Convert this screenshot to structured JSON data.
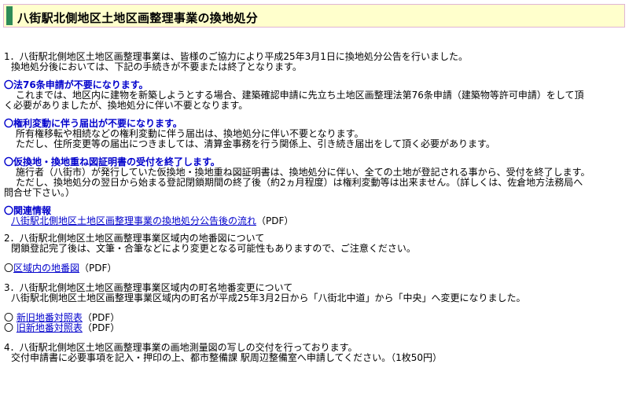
{
  "page": {
    "title": "八街駅北側地区土地区画整理事業の換地処分"
  },
  "section1": {
    "line1": "1．八街駅北側地区土地区画整理事業は、皆様のご協力により平成25年3月1日に換地処分公告を行いました。",
    "line2": "換地処分後においては、下記の手続きが不要または終了となります。"
  },
  "item76": {
    "heading": "〇法76条申請が不要になります。",
    "line1": "これまでは、地区内に建物を新築しようとする場合、建築確認申請に先立ち土地区画整理法第76条申請（建築物等許可申請）をして頂",
    "line2": "く必要がありましたが、換地処分に伴い不要となります。"
  },
  "itemRights": {
    "heading": "〇権利変動に伴う届出が不要になります。",
    "line1": "所有権移転や相続などの権利変動に伴う届出は、換地処分に伴い不要となります。",
    "line2": "ただし、住所変更等の届出につきましては、清算金事務を行う関係上、引き続き届出をして頂く必要があります。"
  },
  "itemCert": {
    "heading": "〇仮換地・換地重ね図証明書の受付を終了します。",
    "line1": "施行者（八街市）が発行していた仮換地・換地重ね図証明書は、換地処分に伴い、全ての土地が登記される事から、受付を終了します。",
    "line2": "ただし、換地処分の翌日から始まる登記閉鎖期間の終了後（約2ヵ月程度）は権利変動等は出来ません。（詳しくは、佐倉地方法務局へ",
    "line3": "問合せ下さい。）"
  },
  "related": {
    "heading": "〇関連情報",
    "link": "八街駅北側地区土地区画整理事業の換地処分公告後の流れ",
    "suffix": "（PDF）"
  },
  "section2": {
    "line1": "2．八街駅北側地区土地区画整理事業区域内の地番図について",
    "line2": "閉鎖登記完了後は、文筆・合筆などにより変更となる可能性もありますので、ご注意ください。",
    "bullet": "〇",
    "link": "区域内の地番図",
    "suffix": "（PDF）"
  },
  "section3": {
    "line1": "3．八街駅北側地区土地区画整理事業区域内の町名地番変更について",
    "line2": "八街駅北側地区土地区画整理事業区域内の町名が平成25年3月2日から「八街北中道」から「中央」へ変更になりました。",
    "items": [
      {
        "bullet": "〇",
        "link": "新旧地番対照表",
        "suffix": "（PDF）"
      },
      {
        "bullet": "〇",
        "link": "旧新地番対照表",
        "suffix": "（PDF）"
      }
    ]
  },
  "section4": {
    "line1": "4．八街駅北側地区土地区画整理事業の画地測量図の写しの交付を行っております。",
    "line2": "交付申請書に必要事項を記入・押印の上、都市整備課 駅周辺整備室へ申請してください。（1枚50円）"
  },
  "colors": {
    "title_bg": "#ffffcc",
    "title_border": "#e0b4d4",
    "accent": "#2e8b57",
    "link": "#0000cc"
  }
}
